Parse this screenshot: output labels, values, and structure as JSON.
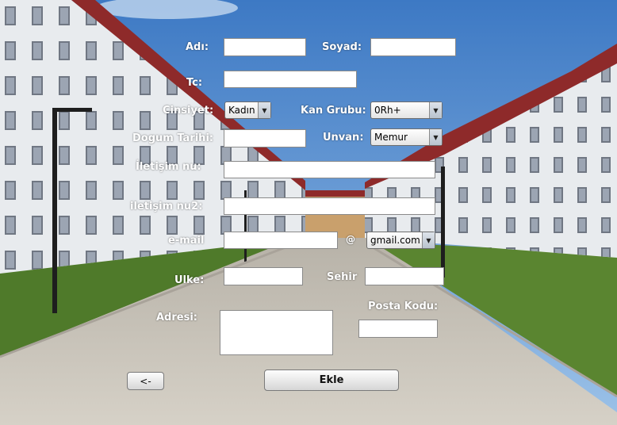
{
  "form": {
    "ad_label": "Adı:",
    "soyad_label": "Soyad:",
    "tc_label": "Tc:",
    "cinsiyet_label": "Cinsiyet:",
    "cinsiyet_value": "Kadın",
    "kan_grubu_label": "Kan Grubu:",
    "kan_grubu_value": "0Rh+",
    "dogum_tarihi_label": "Dogum Tarihi:",
    "unvan_label": "Unvan:",
    "unvan_value": "Memur",
    "iletisim_label": "İletişim nu:",
    "iletisim2_label": "iletişim nu2:",
    "email_label": "e-mail",
    "at_sign": "@",
    "email_domain_value": "gmail.com",
    "ulke_label": "Ulke:",
    "sehir_label": "Sehir",
    "adres_label": "Adresi:",
    "posta_kodu_label": "Posta Kodu:"
  },
  "buttons": {
    "back_label": "<-",
    "add_label": "Ekle"
  },
  "colors": {
    "sky": "#4f86c6",
    "building": "#e9ecef",
    "roof": "#8e2a2a",
    "grass": "#4f7a2a",
    "pavement": "#c9c3b8"
  }
}
